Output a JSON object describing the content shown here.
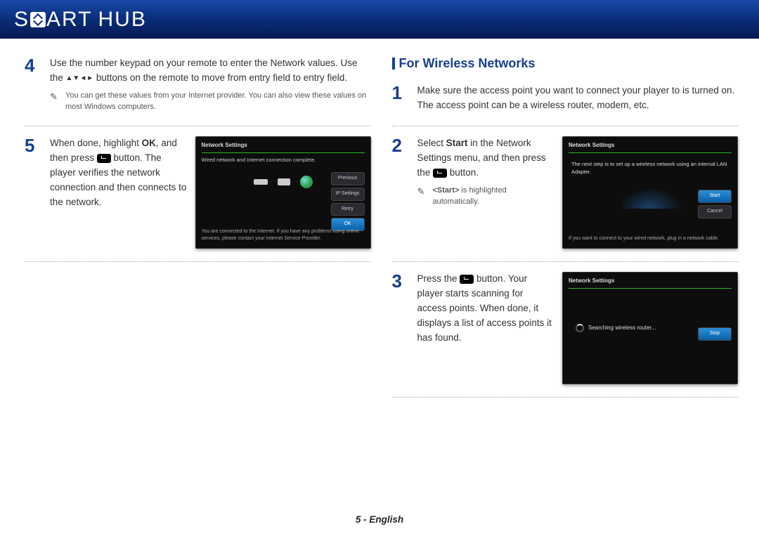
{
  "brand": {
    "s": "S",
    "art": "ART",
    "hub": "HUB"
  },
  "left": {
    "step4": {
      "num": "4",
      "text_line1": "Use the number keypad on your remote to enter the Network values. ",
      "text_line2_a": "Use the ",
      "dir_glyphs": "▲▼◄►",
      "text_line2_b": " buttons on the remote to move from entry field to entry field.",
      "note": "You can get these values from your Internet provider. You can also view these values on most Windows computers."
    },
    "step5": {
      "num": "5",
      "text_a": "When done, highlight ",
      "ok_label": "OK",
      "text_b": ", and then press ",
      "text_c": " button. The player verifies the network connection and then connects to the network.",
      "screen": {
        "title": "Network Settings",
        "msg": "Wired network and Internet connection complete.",
        "btn_prev": "Previous",
        "btn_ip": "IP Settings",
        "btn_retry": "Retry",
        "btn_ok": "OK",
        "bottom": "You are connected to the Internet. If you have any problems using online services, please contact your Internet Service Provider."
      }
    }
  },
  "right": {
    "section_title": "For Wireless Networks",
    "step1": {
      "num": "1",
      "text": "Make sure the access point you want to connect your player to is turned on. The access point can be a wireless router, modem, etc."
    },
    "step2": {
      "num": "2",
      "text_a": "Select ",
      "start_label": "Start",
      "text_b": " in the Network Settings menu, and then press the ",
      "text_c": " button.",
      "note_a": "<Start>",
      "note_b": " is highlighted automatically.",
      "screen": {
        "title": "Network Settings",
        "msg": "The next step is to set up a wireless network using an internal LAN Adapter.",
        "bottom": "If you want to connect to your wired network, plug in a network cable.",
        "btn_start": "Start",
        "btn_cancel": "Cancel"
      }
    },
    "step3": {
      "num": "3",
      "text_a": "Press the ",
      "text_b": " button. Your player starts scanning for access points. When done, it displays a list of access points it has found.",
      "screen": {
        "title": "Network Settings",
        "searching": "Searching wireless router...",
        "btn_stop": "Stop"
      }
    }
  },
  "footer": "5 - English"
}
